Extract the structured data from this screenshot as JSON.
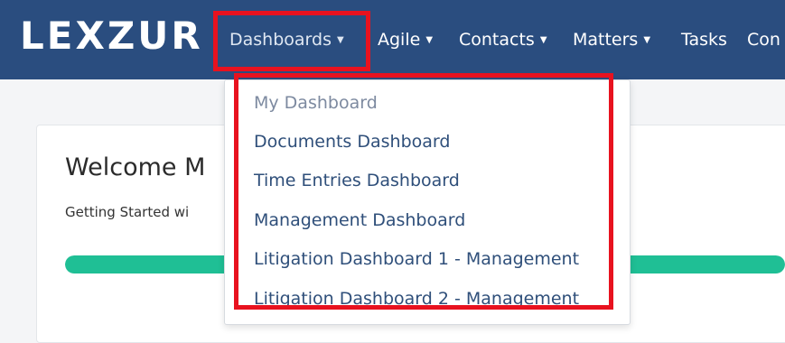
{
  "brand": {
    "logo_text": "LEXZUR"
  },
  "navbar": {
    "items": [
      {
        "label": "Dashboards",
        "has_caret": true
      },
      {
        "label": "Agile",
        "has_caret": true
      },
      {
        "label": "Contacts",
        "has_caret": true
      },
      {
        "label": "Matters",
        "has_caret": true
      },
      {
        "label": "Tasks",
        "has_caret": false
      },
      {
        "label": "Con",
        "has_caret": false
      }
    ]
  },
  "page": {
    "welcome_text": "Welcome M",
    "getting_started_text": "Getting Started wi",
    "progress_fraction": 1.0
  },
  "dropdown": {
    "items": [
      {
        "label": "My Dashboard"
      },
      {
        "label": "Documents Dashboard"
      },
      {
        "label": "Time Entries Dashboard"
      },
      {
        "label": "Management Dashboard"
      },
      {
        "label": "Litigation Dashboard 1 - Management"
      },
      {
        "label": "Litigation Dashboard 2 - Management"
      }
    ]
  },
  "colors": {
    "navbar": "#2a4d7f",
    "highlight": "#e8121f",
    "progress": "#1fbf95",
    "dropdown_text": "#2f4f7a"
  }
}
